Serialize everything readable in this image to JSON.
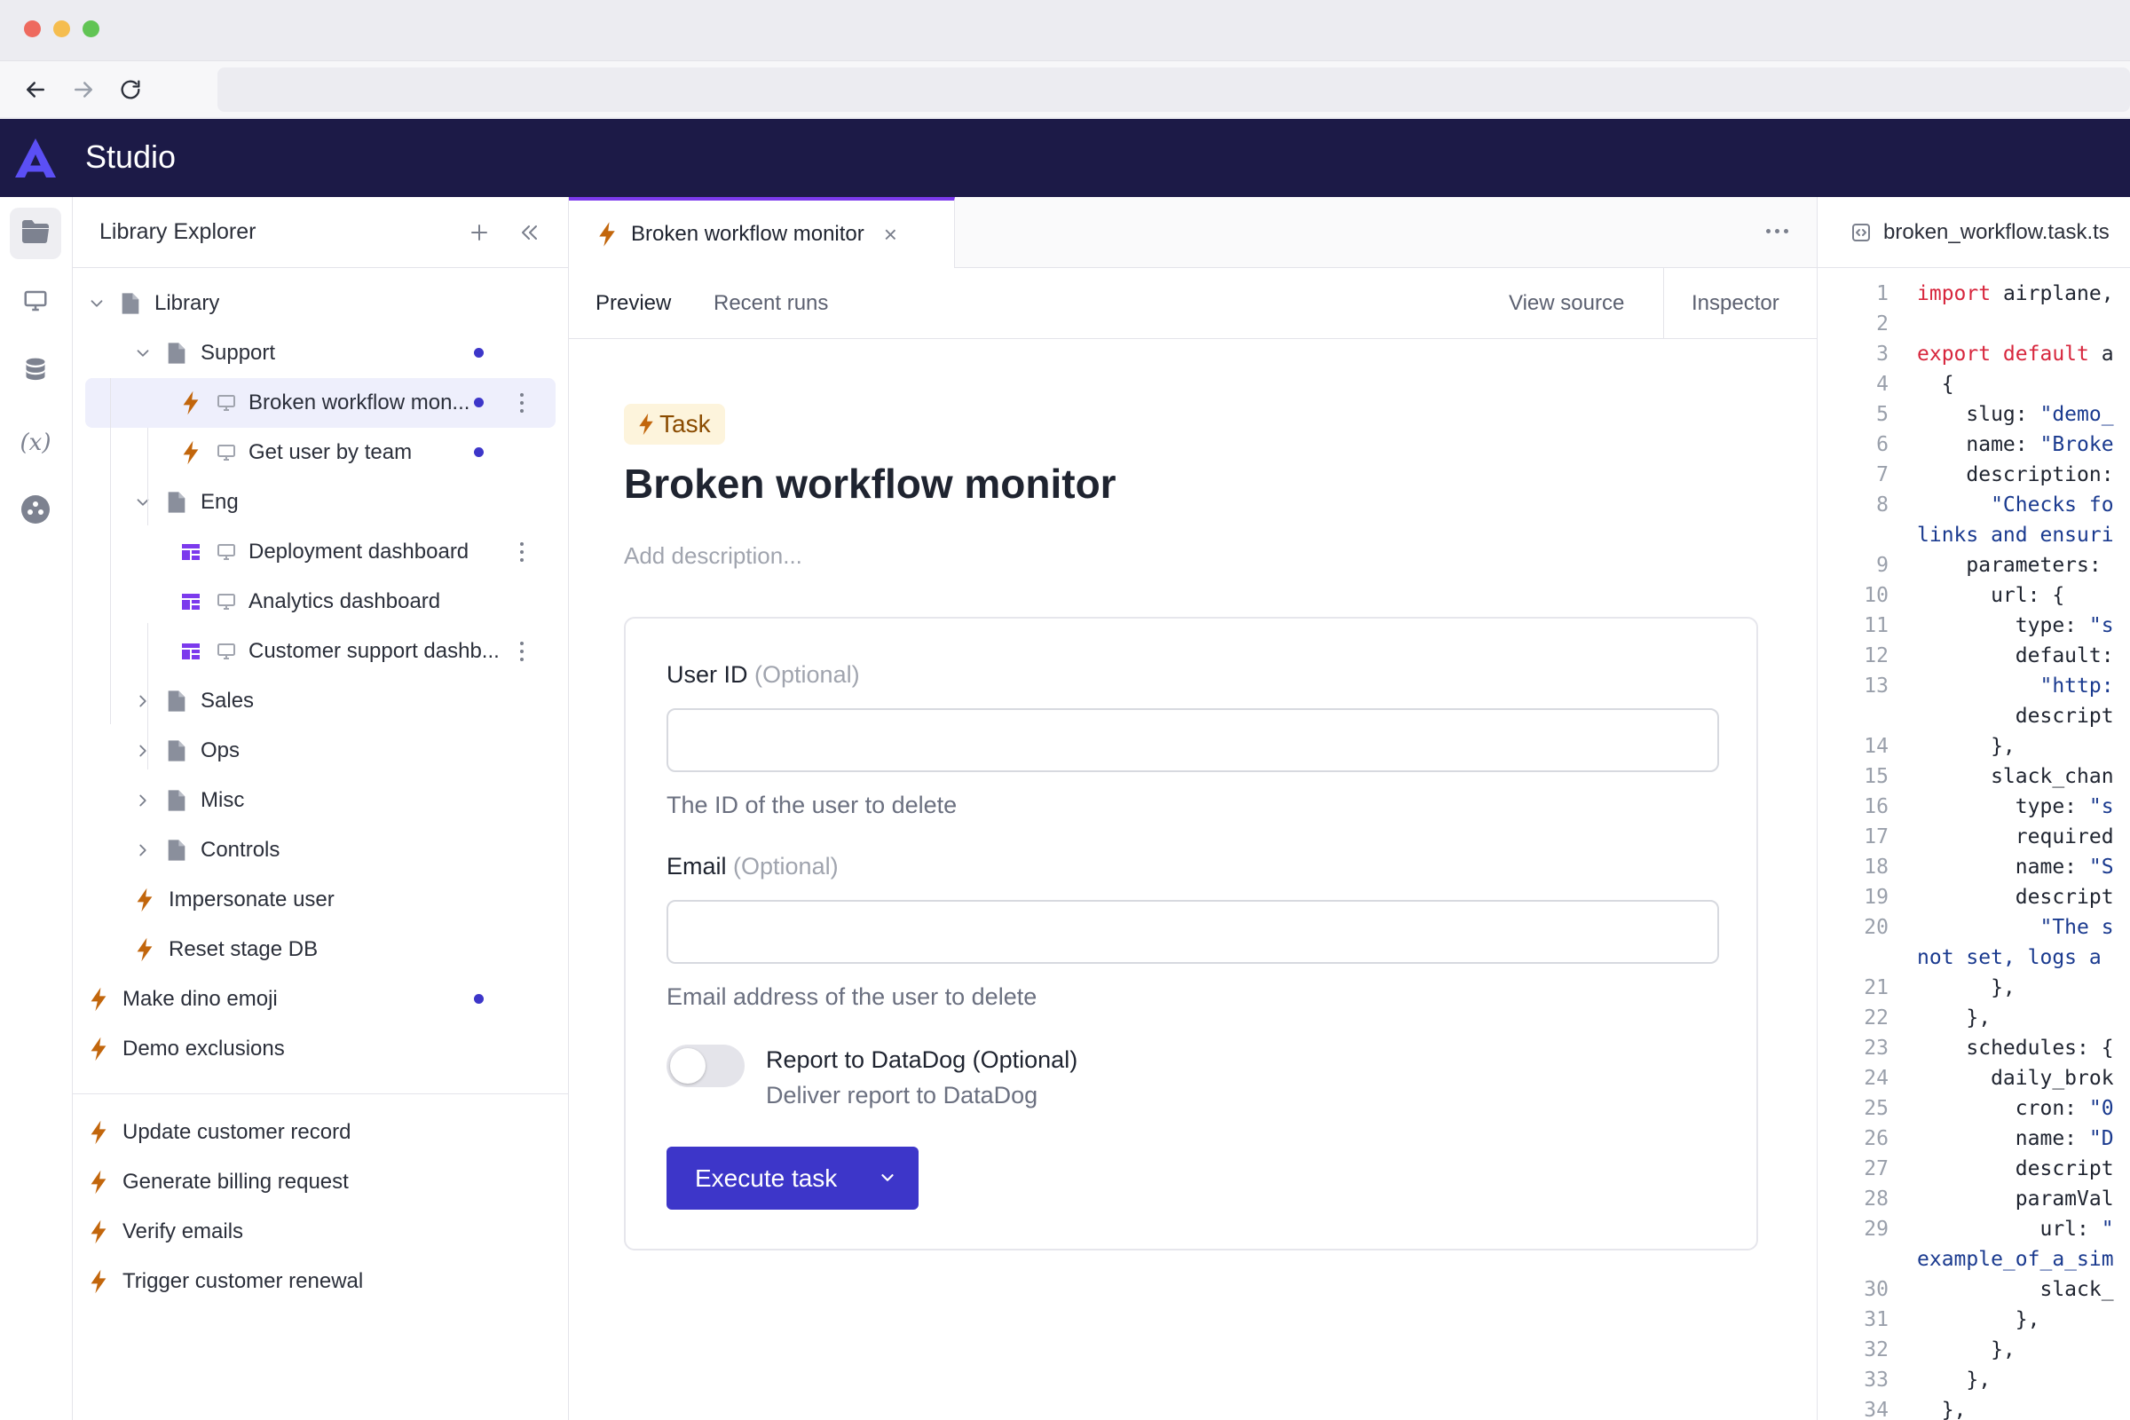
{
  "app": {
    "title": "Studio"
  },
  "explorer": {
    "title": "Library Explorer",
    "tree": [
      {
        "label": "Library",
        "depth": 0,
        "type": "folder",
        "expanded": true
      },
      {
        "label": "Support",
        "depth": 1,
        "type": "folder",
        "expanded": true,
        "dot": true
      },
      {
        "label": "Broken workflow mon...",
        "depth": 2,
        "type": "task",
        "selected": true,
        "dot": true,
        "menu": true
      },
      {
        "label": "Get user by team",
        "depth": 2,
        "type": "task",
        "dot": true
      },
      {
        "label": "Eng",
        "depth": 1,
        "type": "folder",
        "expanded": true
      },
      {
        "label": "Deployment dashboard",
        "depth": 2,
        "type": "view",
        "menu": true
      },
      {
        "label": "Analytics dashboard",
        "depth": 2,
        "type": "view"
      },
      {
        "label": "Customer support dashb...",
        "depth": 2,
        "type": "view",
        "menu": true
      },
      {
        "label": "Sales",
        "depth": 1,
        "type": "folder",
        "expanded": false
      },
      {
        "label": "Ops",
        "depth": 1,
        "type": "folder",
        "expanded": false
      },
      {
        "label": "Misc",
        "depth": 1,
        "type": "folder",
        "expanded": false
      },
      {
        "label": "Controls",
        "depth": 1,
        "type": "folder",
        "expanded": false
      },
      {
        "label": "Impersonate user",
        "depth": 1,
        "type": "bolt"
      },
      {
        "label": "Reset stage DB",
        "depth": 1,
        "type": "bolt"
      },
      {
        "label": "Make dino emoji",
        "depth": 0,
        "type": "bolt",
        "dot": true
      },
      {
        "label": "Demo exclusions",
        "depth": 0,
        "type": "bolt"
      }
    ],
    "bottom_items": [
      {
        "label": "Update customer record"
      },
      {
        "label": "Generate billing request"
      },
      {
        "label": "Verify emails"
      },
      {
        "label": "Trigger customer renewal"
      }
    ]
  },
  "editor": {
    "open_tab": "Broken workflow monitor",
    "subtabs": {
      "preview": "Preview",
      "recent_runs": "Recent runs",
      "view_source": "View source",
      "inspector": "Inspector"
    },
    "badge": "Task",
    "title": "Broken workflow monitor",
    "description_placeholder": "Add description...",
    "fields": {
      "user_id": {
        "label": "User ID",
        "optional": "(Optional)",
        "help": "The ID of the user to delete",
        "value": ""
      },
      "email": {
        "label": "Email",
        "optional": "(Optional)",
        "help": "Email address of the user to delete",
        "value": ""
      },
      "datadog": {
        "label": "Report to DataDog",
        "optional": "(Optional)",
        "help": "Deliver report to DataDog",
        "enabled": false
      }
    },
    "execute_label": "Execute task"
  },
  "code": {
    "filename": "broken_workflow.task.ts",
    "lines": [
      {
        "n": "1",
        "t": [
          [
            "kw",
            "import"
          ],
          [
            "p",
            " airplane,"
          ]
        ]
      },
      {
        "n": "2",
        "t": []
      },
      {
        "n": "3",
        "t": [
          [
            "kw",
            "export default"
          ],
          [
            "p",
            " a"
          ]
        ]
      },
      {
        "n": "4",
        "t": [
          [
            "p",
            "  {"
          ]
        ]
      },
      {
        "n": "5",
        "t": [
          [
            "p",
            "    slug: "
          ],
          [
            "str",
            "\"demo_"
          ]
        ]
      },
      {
        "n": "6",
        "t": [
          [
            "p",
            "    name: "
          ],
          [
            "str",
            "\"Broke"
          ]
        ]
      },
      {
        "n": "7",
        "t": [
          [
            "p",
            "    description:"
          ]
        ]
      },
      {
        "n": "8",
        "t": [
          [
            "str",
            "      \"Checks fo"
          ]
        ]
      },
      {
        "n": "",
        "t": [
          [
            "str",
            "links and ensuri"
          ]
        ]
      },
      {
        "n": "9",
        "t": [
          [
            "p",
            "    parameters:"
          ]
        ]
      },
      {
        "n": "10",
        "t": [
          [
            "p",
            "      url: {"
          ]
        ]
      },
      {
        "n": "11",
        "t": [
          [
            "p",
            "        type: "
          ],
          [
            "str",
            "\"s"
          ]
        ]
      },
      {
        "n": "12",
        "t": [
          [
            "p",
            "        default:"
          ]
        ]
      },
      {
        "n": "13",
        "t": [
          [
            "str",
            "          \"http:"
          ]
        ]
      },
      {
        "n": "",
        "t": [
          [
            "p",
            "        descript"
          ]
        ]
      },
      {
        "n": "14",
        "t": [
          [
            "p",
            "      },"
          ]
        ]
      },
      {
        "n": "15",
        "t": [
          [
            "p",
            "      slack_chan"
          ]
        ]
      },
      {
        "n": "16",
        "t": [
          [
            "p",
            "        type: "
          ],
          [
            "str",
            "\"s"
          ]
        ]
      },
      {
        "n": "17",
        "t": [
          [
            "p",
            "        required"
          ]
        ]
      },
      {
        "n": "18",
        "t": [
          [
            "p",
            "        name: "
          ],
          [
            "str",
            "\"S"
          ]
        ]
      },
      {
        "n": "19",
        "t": [
          [
            "p",
            "        descript"
          ]
        ]
      },
      {
        "n": "20",
        "t": [
          [
            "str",
            "          \"The s"
          ]
        ]
      },
      {
        "n": "",
        "t": [
          [
            "str",
            "not set, logs a"
          ]
        ]
      },
      {
        "n": "21",
        "t": [
          [
            "p",
            "      },"
          ]
        ]
      },
      {
        "n": "22",
        "t": [
          [
            "p",
            "    },"
          ]
        ]
      },
      {
        "n": "23",
        "t": [
          [
            "p",
            "    schedules: {"
          ]
        ]
      },
      {
        "n": "24",
        "t": [
          [
            "p",
            "      daily_brok"
          ]
        ]
      },
      {
        "n": "25",
        "t": [
          [
            "p",
            "        cron: "
          ],
          [
            "str",
            "\"0"
          ]
        ]
      },
      {
        "n": "26",
        "t": [
          [
            "p",
            "        name: "
          ],
          [
            "str",
            "\"D"
          ]
        ]
      },
      {
        "n": "27",
        "t": [
          [
            "p",
            "        descript"
          ]
        ]
      },
      {
        "n": "28",
        "t": [
          [
            "p",
            "        paramVal"
          ]
        ]
      },
      {
        "n": "29",
        "t": [
          [
            "p",
            "          url: "
          ],
          [
            "str",
            "\""
          ]
        ]
      },
      {
        "n": "",
        "t": [
          [
            "str",
            "example_of_a_sim"
          ]
        ]
      },
      {
        "n": "30",
        "t": [
          [
            "p",
            "          slack_"
          ]
        ]
      },
      {
        "n": "31",
        "t": [
          [
            "p",
            "        },"
          ]
        ]
      },
      {
        "n": "32",
        "t": [
          [
            "p",
            "      },"
          ]
        ]
      },
      {
        "n": "33",
        "t": [
          [
            "p",
            "    },"
          ]
        ]
      },
      {
        "n": "34",
        "t": [
          [
            "p",
            "  },"
          ]
        ]
      }
    ]
  },
  "colors": {
    "header_bg": "#1c1a47",
    "accent": "#3d36c9",
    "tab_accent": "#7c3aed",
    "bolt": "#c2660c",
    "view_icon": "#7c3aed"
  }
}
